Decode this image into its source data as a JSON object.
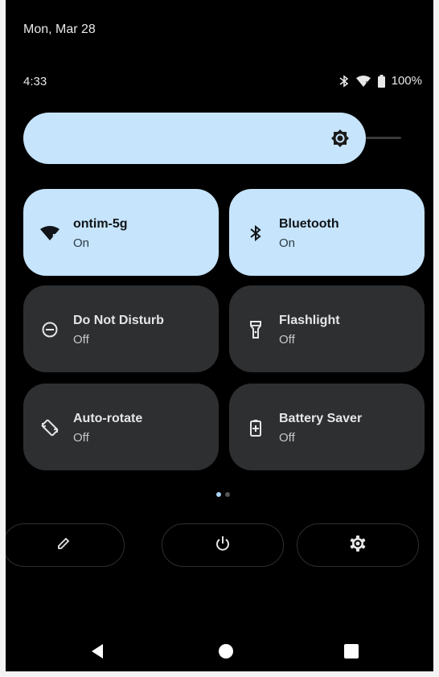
{
  "status": {
    "date": "Mon, Mar 28",
    "time": "4:33",
    "battery": "100%",
    "icons": [
      "bluetooth-icon",
      "wifi-icon",
      "battery-icon"
    ]
  },
  "brightness": {
    "icon": "brightness-icon",
    "level": 0.85
  },
  "tiles": [
    {
      "title": "ontim-5g",
      "state": "On",
      "icon": "wifi-icon",
      "active": true
    },
    {
      "title": "Bluetooth",
      "state": "On",
      "icon": "bluetooth-icon",
      "active": true
    },
    {
      "title": "Do Not Disturb",
      "state": "Off",
      "icon": "do-not-disturb-icon",
      "active": false
    },
    {
      "title": "Flashlight",
      "state": "Off",
      "icon": "flashlight-icon",
      "active": false
    },
    {
      "title": "Auto-rotate",
      "state": "Off",
      "icon": "auto-rotate-icon",
      "active": false
    },
    {
      "title": "Battery Saver",
      "state": "Off",
      "icon": "battery-saver-icon",
      "active": false
    }
  ],
  "pager": {
    "pages": 2,
    "current": 1
  },
  "bottom_buttons": [
    "edit-icon",
    "power-icon",
    "settings-icon"
  ],
  "navigation": [
    "back-icon",
    "home-icon",
    "recents-icon"
  ],
  "colors": {
    "tile_on": "#c6e4fb",
    "tile_off": "#2d2f31",
    "background": "#000000"
  }
}
